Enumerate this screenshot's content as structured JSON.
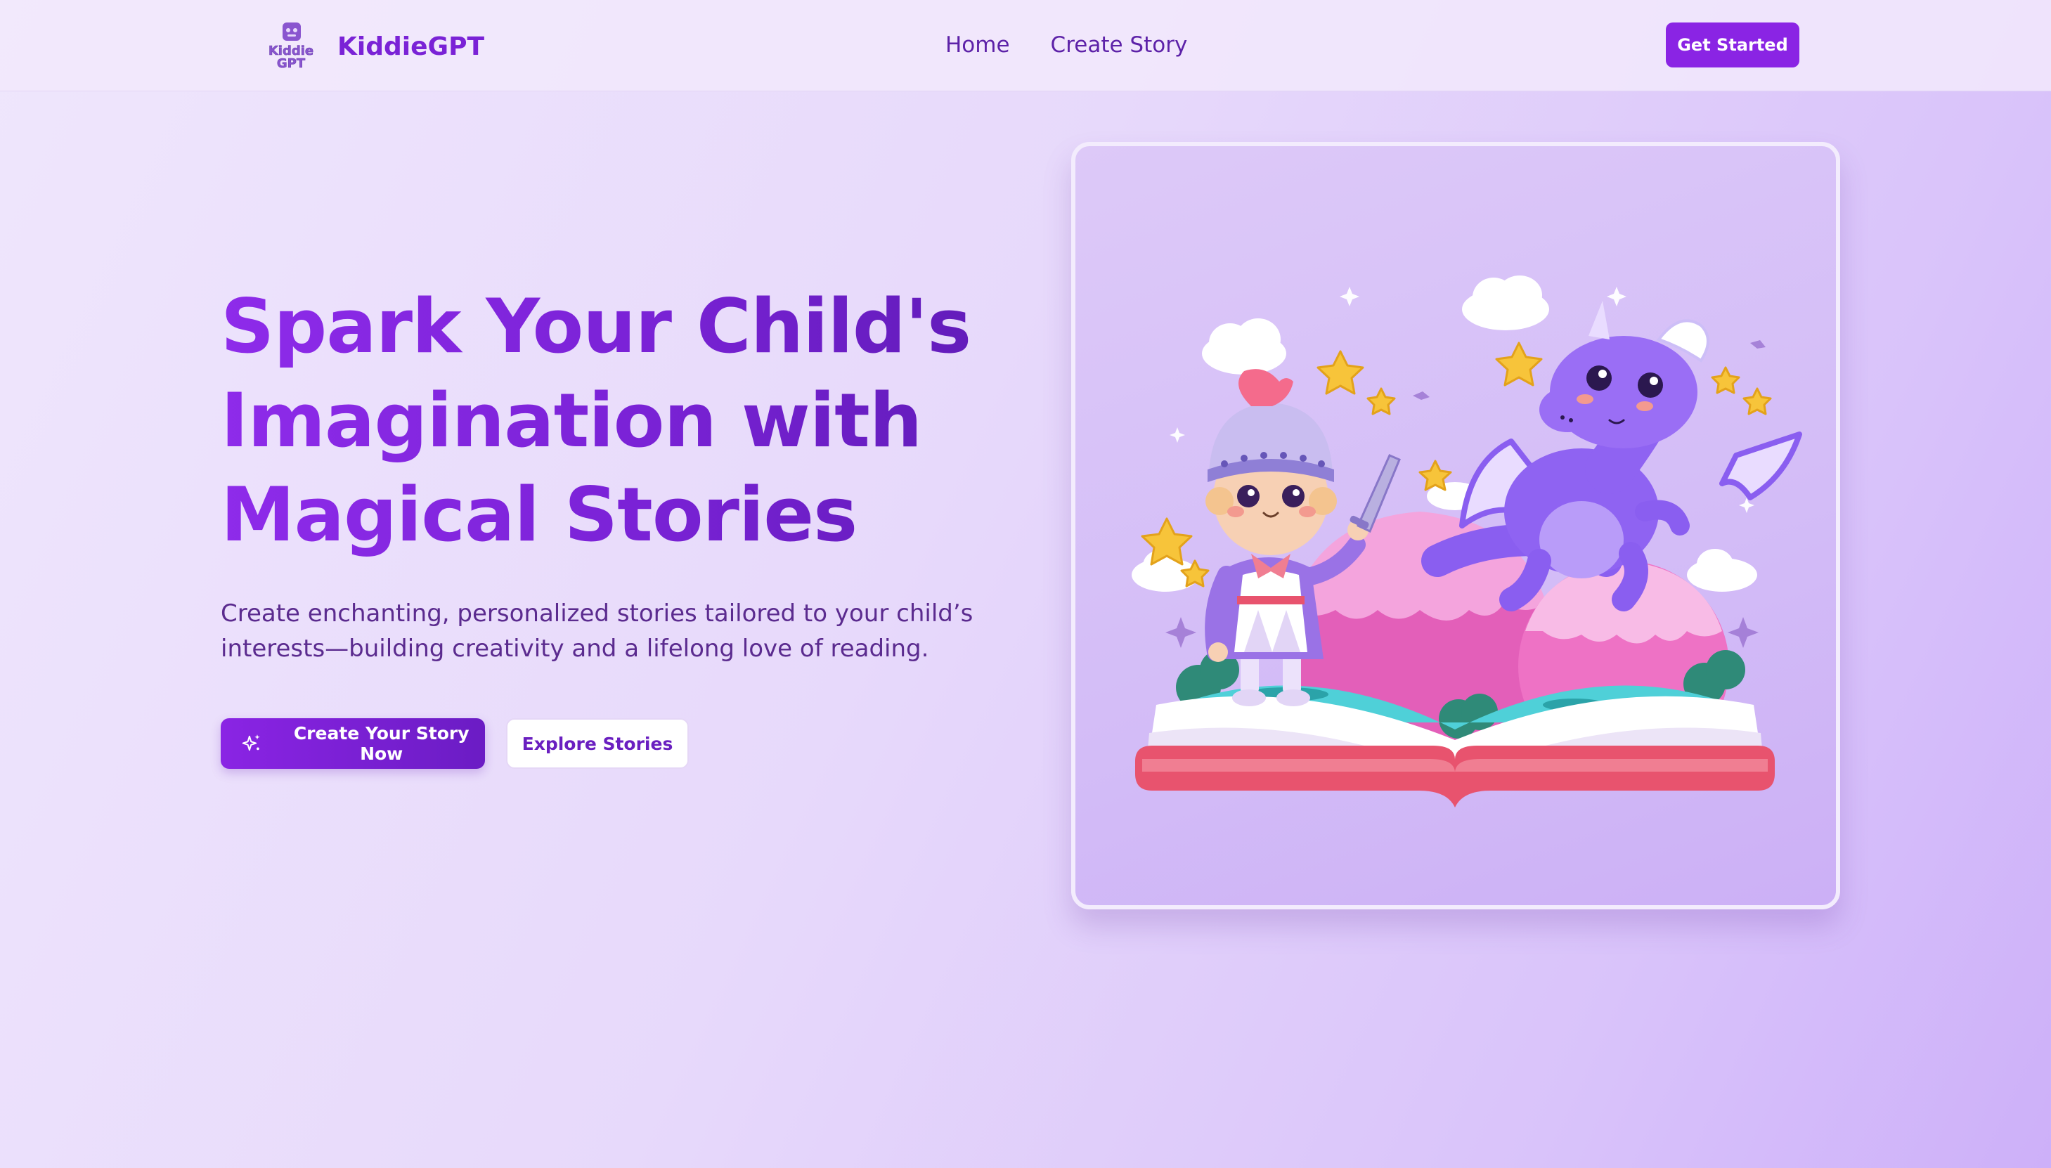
{
  "nav": {
    "brand": "KiddieGPT",
    "logo_text": "Kiddie GPT",
    "links": [
      "Home",
      "Create Story"
    ],
    "cta": "Get Started"
  },
  "hero": {
    "title_lines": [
      "Spark Your Child's",
      "Imagination with",
      "Magical Stories"
    ],
    "subtitle_lines": [
      "Create enchanting, personalized stories tailored to your child’s",
      "interests—building creativity and a lifelong love of reading."
    ],
    "primary_button": "Create Your Story Now",
    "secondary_button": "Explore Stories"
  },
  "illustration": {
    "icons": [
      "sparkles-icon",
      "robot-logo-icon"
    ],
    "subject": "knight-and-dragon-on-storybook"
  },
  "colors": {
    "accent": "#8a24e4",
    "accent_dark": "#6b1cc4",
    "text_purple": "#5b2b8f",
    "background": "#e7d9fb"
  }
}
